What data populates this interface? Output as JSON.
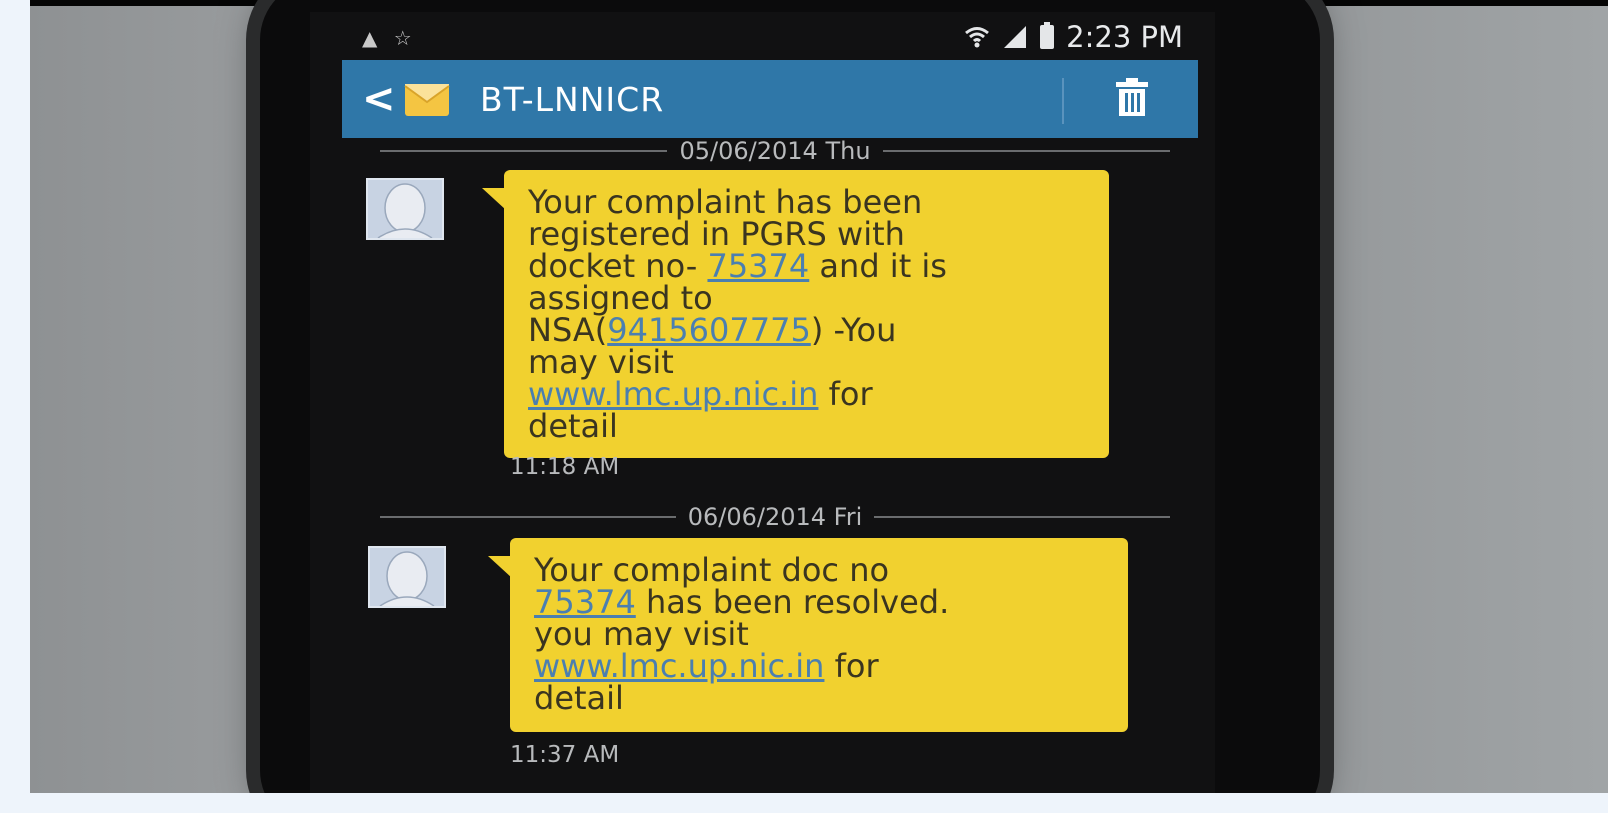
{
  "status_bar": {
    "left_icons": [
      "notification-icon",
      "star-icon"
    ],
    "time": "2:23 PM"
  },
  "header": {
    "back": "<",
    "contact": "BT-LNNICR"
  },
  "messages": [
    {
      "date": "05/06/2014 Thu",
      "lines": [
        {
          "pre": "Your complaint has been",
          "link": "",
          "post": ""
        },
        {
          "pre": "registered in PGRS with",
          "link": "",
          "post": ""
        },
        {
          "pre": "docket no- ",
          "link": "75374",
          "post": " and it is"
        },
        {
          "pre": "assigned to",
          "link": "",
          "post": ""
        },
        {
          "pre": "NSA(",
          "link": "9415607775",
          "post": ") -You"
        },
        {
          "pre": "may visit",
          "link": "",
          "post": ""
        },
        {
          "pre": "",
          "link": "www.lmc.up.nic.in",
          "post": " for"
        },
        {
          "pre": "detail",
          "link": "",
          "post": ""
        }
      ],
      "time": "11:18 AM"
    },
    {
      "date": "06/06/2014 Fri",
      "lines": [
        {
          "pre": "Your complaint doc no",
          "link": "",
          "post": ""
        },
        {
          "pre": "",
          "link": "75374",
          "post": " has been resolved."
        },
        {
          "pre": "you may visit",
          "link": "",
          "post": ""
        },
        {
          "pre": "",
          "link": "www.lmc.up.nic.in",
          "post": " for"
        },
        {
          "pre": "detail",
          "link": "",
          "post": ""
        }
      ],
      "time": "11:37 AM"
    }
  ],
  "colors": {
    "header_bg": "#2f77a8",
    "bubble_bg": "#f1d12f",
    "link": "#4b7fb0"
  }
}
